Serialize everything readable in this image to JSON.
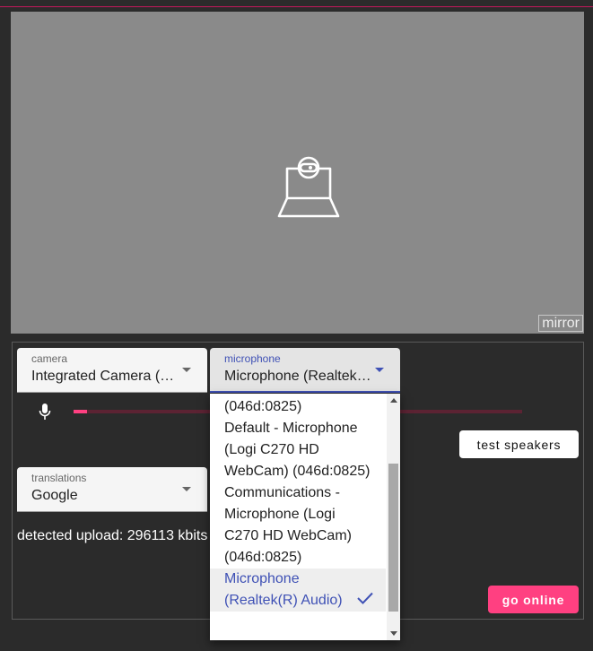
{
  "preview": {
    "mirror_label": "mirror"
  },
  "camera": {
    "label": "camera",
    "value": "Integrated Camera (…"
  },
  "microphone": {
    "label": "microphone",
    "value": "Microphone (Realtek…",
    "level": 0.03,
    "options": [
      {
        "label": "(046d:0825)"
      },
      {
        "label": "Default - Microphone (Logi C270 HD WebCam) (046d:0825)"
      },
      {
        "label": "Communications - Microphone (Logi C270 HD WebCam) (046d:0825)"
      },
      {
        "label": "Microphone (Realtek(R) Audio)",
        "selected": true
      }
    ]
  },
  "translations": {
    "label": "translations",
    "value": "Google"
  },
  "buttons": {
    "test_speakers": "test speakers",
    "go_online": "go online"
  },
  "status": {
    "upload": "detected upload: 296113 kbits"
  },
  "colors": {
    "accent_pink": "#ff4081",
    "accent_indigo": "#3f51b5",
    "background": "#2b2b2b",
    "preview_gray": "#8a8a8a"
  }
}
